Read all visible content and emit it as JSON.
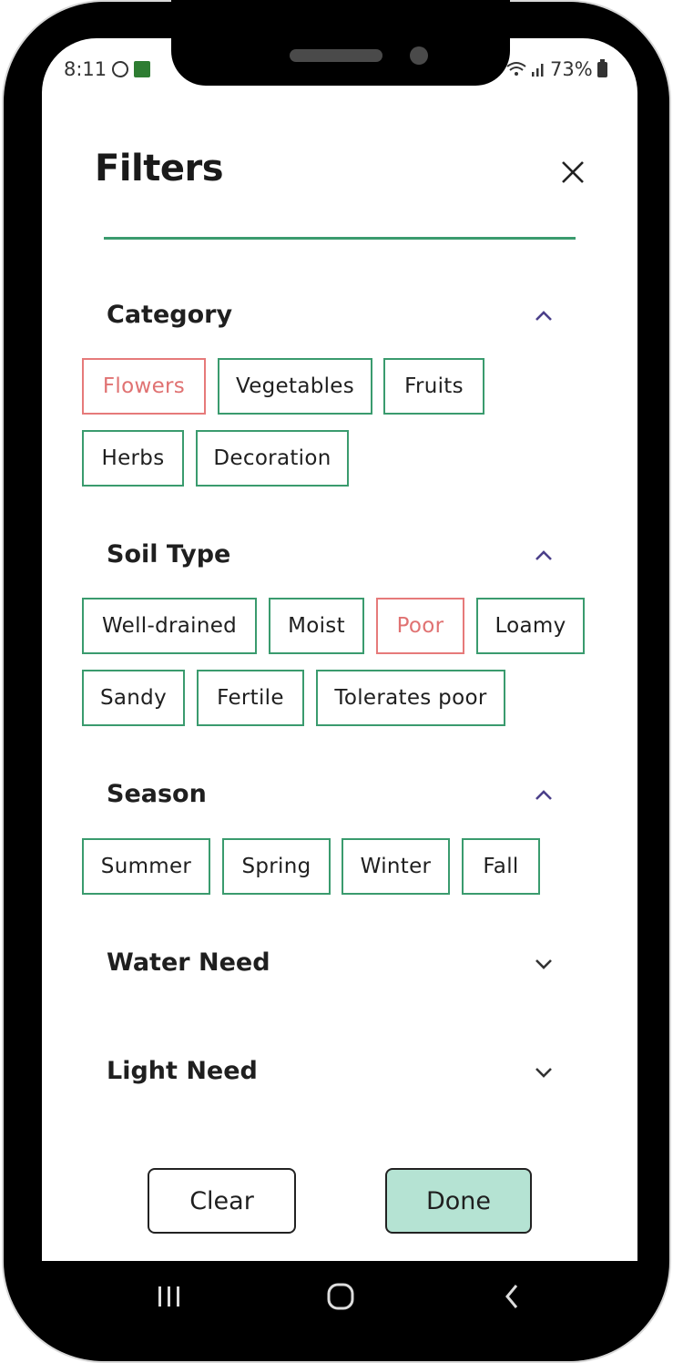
{
  "status_bar": {
    "time": "8:11",
    "battery": "73%"
  },
  "header": {
    "title": "Filters",
    "close_icon": "close-icon"
  },
  "sections": {
    "category": {
      "title": "Category",
      "expanded": true,
      "chips": [
        "Flowers",
        "Vegetables",
        "Fruits",
        "Herbs",
        "Decoration"
      ],
      "selected": [
        "Flowers"
      ]
    },
    "soil_type": {
      "title": "Soil Type",
      "expanded": true,
      "chips": [
        "Well-drained",
        "Moist",
        "Poor",
        "Loamy",
        "Sandy",
        "Fertile",
        "Tolerates poor"
      ],
      "selected": [
        "Poor"
      ]
    },
    "season": {
      "title": "Season",
      "expanded": true,
      "chips": [
        "Summer",
        "Spring",
        "Winter",
        "Fall"
      ],
      "selected": []
    },
    "water_need": {
      "title": "Water Need",
      "expanded": false
    },
    "light_need": {
      "title": "Light Need",
      "expanded": false
    }
  },
  "actions": {
    "clear_label": "Clear",
    "done_label": "Done"
  },
  "colors": {
    "accent_green": "#3a9b6e",
    "selected_red": "#e07272",
    "done_fill": "#b5e3d3",
    "chevron": "#4b3f8a"
  }
}
